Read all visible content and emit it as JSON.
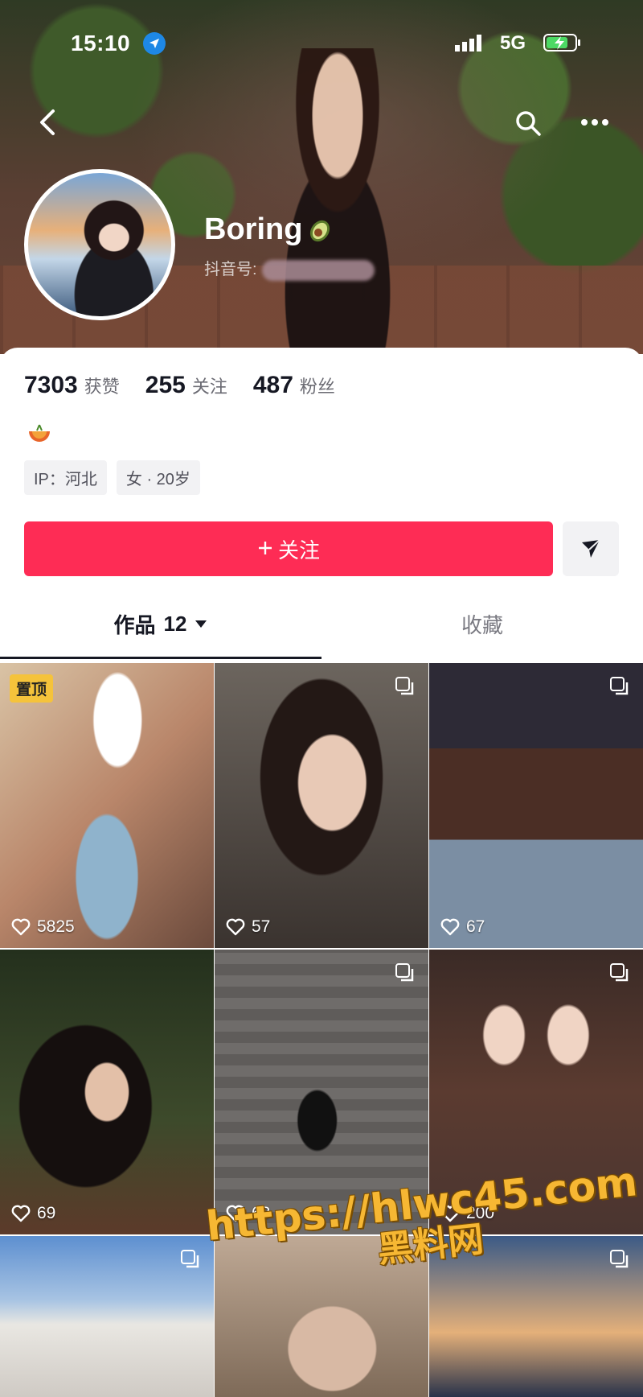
{
  "status_bar": {
    "time": "15:10",
    "network": "5G"
  },
  "profile": {
    "name": "Boring",
    "id_label": "抖音号:",
    "stats": [
      {
        "value": "7303",
        "label": "获赞"
      },
      {
        "value": "255",
        "label": "关注"
      },
      {
        "value": "487",
        "label": "粉丝"
      }
    ],
    "tags": [
      "IP：河北",
      "女 · 20岁"
    ],
    "follow_label": "关注"
  },
  "tabs": {
    "works_label": "作品",
    "works_count": "12",
    "favorites_label": "收藏"
  },
  "grid": {
    "pin_label": "置顶",
    "items": [
      {
        "likes": "5825"
      },
      {
        "likes": "57"
      },
      {
        "likes": "67"
      },
      {
        "likes": "69"
      },
      {
        "likes": "63"
      },
      {
        "likes": "200"
      }
    ]
  },
  "watermark": {
    "url": "https://hlwc45.com",
    "name": "黑料网"
  }
}
